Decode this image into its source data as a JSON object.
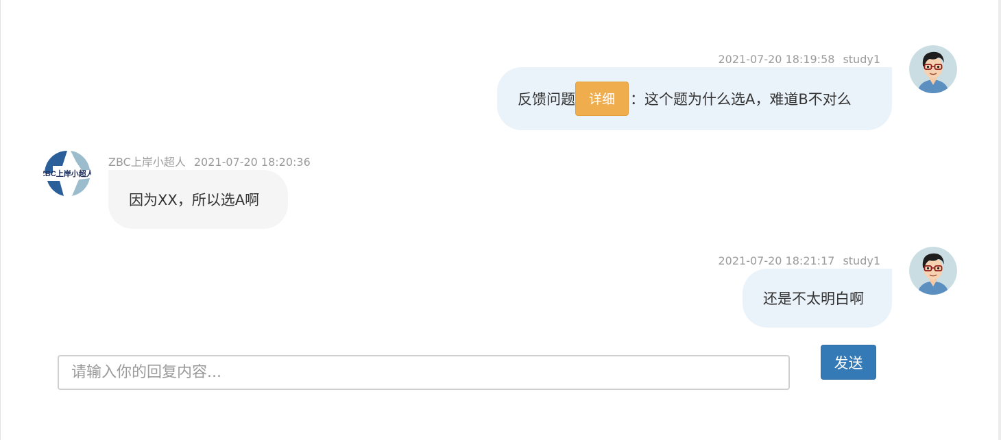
{
  "messages": [
    {
      "side": "self",
      "time": "2021-07-20 18:19:58",
      "user": "study1",
      "text_before": "反馈问题",
      "button_label": "详细",
      "text_after": "：这个题为什么选A，难道B不对么",
      "avatar_icon": "cartoon-man-with-glasses"
    },
    {
      "side": "other",
      "user": "ZBC上岸小超人",
      "time": "2021-07-20 18:20:36",
      "text": "因为XX，所以选A啊",
      "avatar_icon": "zbc-logo",
      "avatar_text": "ZBC上岸小超人"
    },
    {
      "side": "self",
      "time": "2021-07-20 18:21:17",
      "user": "study1",
      "text": "还是不太明白啊",
      "avatar_icon": "cartoon-man-with-glasses"
    }
  ],
  "reply": {
    "placeholder": "请输入你的回复内容...",
    "value": "",
    "send_label": "发送"
  },
  "colors": {
    "self_bubble": "#eaf2fa",
    "other_bubble": "#f5f5f5",
    "detail_button": "#f0ad4e",
    "send_button": "#337ab7",
    "meta_text": "#9a9a9a"
  }
}
